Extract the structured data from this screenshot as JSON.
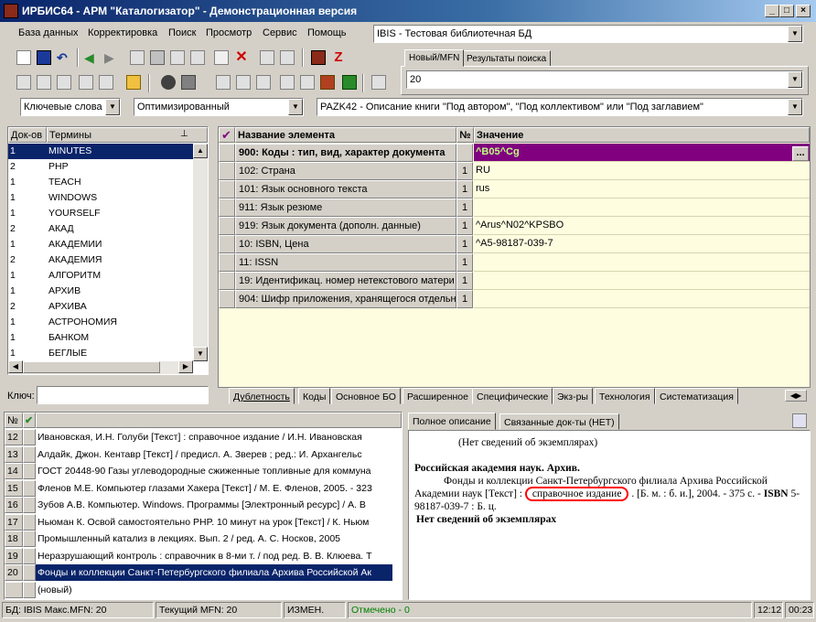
{
  "window": {
    "title": "ИРБИС64 - АРМ \"Каталогизатор\" - Демонстрационная версия",
    "minimize": "_",
    "maximize": "□",
    "close": "×"
  },
  "menu": [
    "База данных",
    "Корректировка",
    "Поиск",
    "Просмотр",
    "Сервис",
    "Помощь"
  ],
  "db_select": "IBIS - Тестовая библиотечная БД",
  "right_tabs": [
    "Новый/MFN",
    "Результаты поиска"
  ],
  "mfn_value": "20",
  "search_type": "Ключевые слова",
  "optimization": "Оптимизированный",
  "worksheet": "PAZK42 - Описание книги \"Под автором\", \"Под коллективом\" или \"Под заглавием\"",
  "terms": {
    "headers": [
      "Док-ов",
      "Термины"
    ],
    "rows": [
      [
        "1",
        "MINUTES"
      ],
      [
        "2",
        "PHP"
      ],
      [
        "1",
        "TEACH"
      ],
      [
        "1",
        "WINDOWS"
      ],
      [
        "1",
        "YOURSELF"
      ],
      [
        "2",
        "АКАД"
      ],
      [
        "1",
        "АКАДЕМИИ"
      ],
      [
        "2",
        "АКАДЕМИЯ"
      ],
      [
        "1",
        "АЛГОРИТМ"
      ],
      [
        "1",
        "АРХИВ"
      ],
      [
        "2",
        "АРХИВА"
      ],
      [
        "1",
        "АСТРОНОМИЯ"
      ],
      [
        "1",
        "БАНКОМ"
      ],
      [
        "1",
        "БЕГЛЫЕ"
      ]
    ],
    "key_label": "Ключ:"
  },
  "grid": {
    "headers": {
      "check": "✔",
      "name": "Название элемента",
      "no": "№",
      "value": "Значение"
    },
    "rows": [
      {
        "name": "900: Коды : тип, вид, характер документа",
        "no": "",
        "value": "^B05^Cg",
        "bold": true
      },
      {
        "name": "102: Страна",
        "no": "1",
        "value": "RU"
      },
      {
        "name": "101: Язык основного текста",
        "no": "1",
        "value": "rus"
      },
      {
        "name": "911: Язык резюме",
        "no": "1",
        "value": ""
      },
      {
        "name": "919: Язык документа (дополн. данные)",
        "no": "1",
        "value": "^Arus^N02^KPSBO"
      },
      {
        "name": "10: ISBN, Цена",
        "no": "1",
        "value": "^A5-98187-039-7"
      },
      {
        "name": "11: ISSN",
        "no": "1",
        "value": ""
      },
      {
        "name": "19: Идентификац. номер нетекстового матери",
        "no": "1",
        "value": ""
      },
      {
        "name": "904: Шифр приложения, хранящегося отдельно",
        "no": "1",
        "value": ""
      }
    ],
    "ellipsis": "..."
  },
  "grid_tabs": [
    "Дублетность",
    "Коды",
    "Основное БО",
    "Расширенное",
    "Специфические",
    "Экз-ры",
    "Технология",
    "Систематизация"
  ],
  "results": {
    "headers": {
      "no": "№",
      "check": "✔"
    },
    "rows": [
      [
        "12",
        "Ивановская, И.Н. Голуби [Текст] : справочное издание / И.Н. Ивановская"
      ],
      [
        "13",
        "Алдайк, Джон. Кентавр [Текст] / предисл. А. Зверев ; ред.: И. Архангельс"
      ],
      [
        "14",
        "ГОСТ 20448-90 Газы углеводородные сжиженные топливные для коммуна"
      ],
      [
        "15",
        "Фленов М.Е. Компьютер глазами Хакера [Текст] / М. Е. Фленов, 2005. - 323"
      ],
      [
        "16",
        "Зубов А.В. Компьютер. Windows. Программы [Электронный ресурс] / А. В"
      ],
      [
        "17",
        "Ньюман К. Освой самостоятельно PHP. 10 минут на урок [Текст] / К. Ньюм"
      ],
      [
        "18",
        "Промышленный катализ в лекциях. Вып. 2 / ред. А. С. Носков, 2005"
      ],
      [
        "19",
        "Неразрушающий контроль : справочник в 8-ми т. / под ред. В. В. Клюева. Т"
      ],
      [
        "20",
        "Фонды и коллекции Санкт-Петербургского филиала Архива Российской Ак"
      ],
      [
        "",
        "(новый)"
      ]
    ]
  },
  "desc_tabs": [
    "Полное описание",
    "Связанные док-ты (НЕТ)"
  ],
  "description": {
    "line1": "(Нет сведений об экземплярах)",
    "heading": "Российская академия наук. Архив.",
    "body_a": "Фонды и коллекции Санкт-Петербургского филиала Архива Российской Академии наук [Текст] : ",
    "highlight": "справочное издание",
    "body_b": " . [Б. м. : б. и.], 2004. - 375 с. - ",
    "isbn": "ISBN",
    "body_c": " 5-98187-039-7 : Б. ц.",
    "footer": "Нет сведений об экземплярах"
  },
  "status": {
    "db": "БД: IBIS Макс.MFN: 20",
    "current": "Текущий MFN: 20",
    "changed": "ИЗМЕН.",
    "marked": "Отмечено - 0",
    "time": "12:12",
    "elapsed": "00:23"
  },
  "colors": {
    "selection": "#0a246a",
    "grid_bg": "#fffde0",
    "code_row": "#800080",
    "marked": "#008000",
    "highlight_ring": "#ff0000"
  }
}
